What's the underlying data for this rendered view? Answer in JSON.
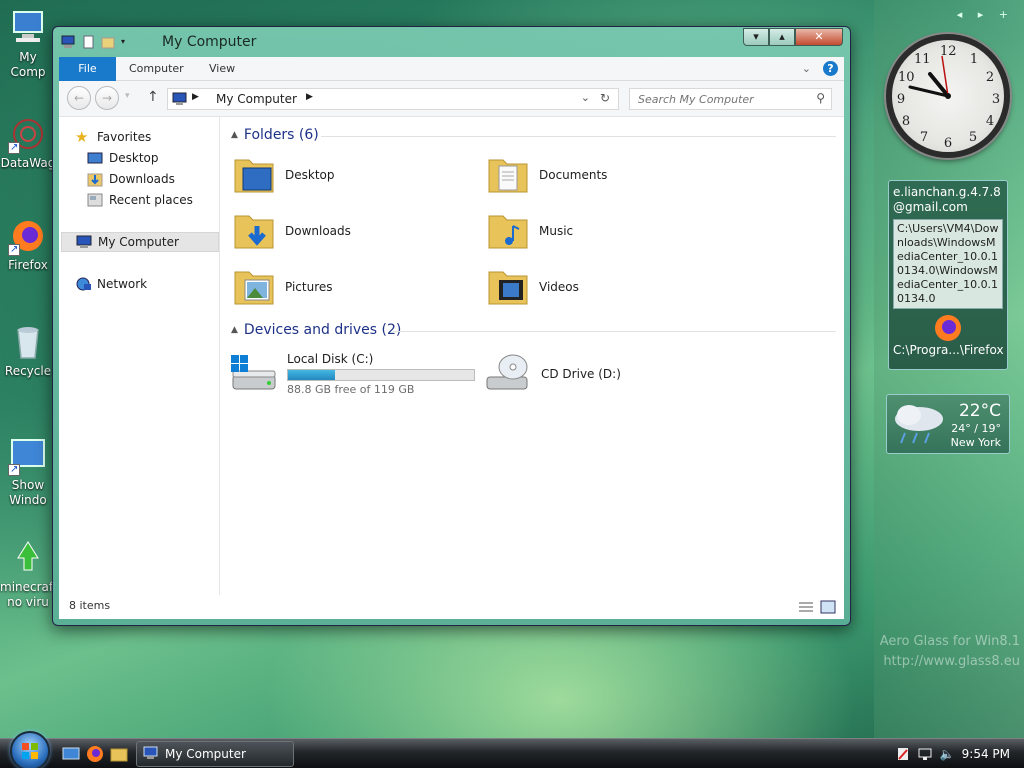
{
  "desktop": {
    "icons": [
      {
        "label": "My Comp",
        "icon": "computer-icon"
      },
      {
        "label": "DataWag",
        "icon": "datawag-icon"
      },
      {
        "label": "Firefox",
        "icon": "firefox-icon"
      },
      {
        "label": "Recycle",
        "icon": "recycle-bin-icon"
      },
      {
        "label": "Show Windo",
        "icon": "show-desktop-icon"
      },
      {
        "label": "minecraft no viru",
        "icon": "minecraft-icon"
      }
    ],
    "watermark_line1": "Aero Glass for Win8.1",
    "watermark_line2": "http://www.glass8.eu"
  },
  "sidebar": {
    "controls": "◂ ▸ +",
    "clock_numbers": [
      "12",
      "1",
      "2",
      "3",
      "4",
      "5",
      "6",
      "7",
      "8",
      "9",
      "10",
      "11"
    ],
    "clock_time": "9:54",
    "gadget": {
      "email": "e.lianchan.g.4.7.8 @gmail.com",
      "path": "C:\\Users\\VM4\\Downloads\\WindowsMediaCenter_10.0.10134.0\\WindowsMediaCenter_10.0.10134.0",
      "shortcut_label": "C:\\Progra...\\Firefox"
    },
    "weather": {
      "temp": "22°C",
      "range": "24° / 19°",
      "city": "New York"
    }
  },
  "window": {
    "title": "My Computer",
    "ribbon": {
      "tabs": [
        "File",
        "Computer",
        "View"
      ]
    },
    "address": {
      "crumb": "My Computer"
    },
    "search": {
      "placeholder": "Search My Computer"
    },
    "nav": {
      "favorites": "Favorites",
      "desktop": "Desktop",
      "downloads": "Downloads",
      "recent": "Recent places",
      "my_computer": "My Computer",
      "network": "Network"
    },
    "folders_heading": "Folders (6)",
    "folders": [
      {
        "label": "Desktop",
        "icon": "desktop-folder-icon"
      },
      {
        "label": "Documents",
        "icon": "documents-folder-icon"
      },
      {
        "label": "Downloads",
        "icon": "downloads-folder-icon"
      },
      {
        "label": "Music",
        "icon": "music-folder-icon"
      },
      {
        "label": "Pictures",
        "icon": "pictures-folder-icon"
      },
      {
        "label": "Videos",
        "icon": "videos-folder-icon"
      }
    ],
    "drives_heading": "Devices and drives (2)",
    "drives": {
      "local": {
        "label": "Local Disk (C:)",
        "free": "88.8 GB free of 119 GB",
        "used_fraction": 0.254
      },
      "cd": {
        "label": "CD Drive (D:)"
      }
    },
    "status": "8 items"
  },
  "taskbar": {
    "task_label": "My Computer",
    "time": "9:54 PM"
  },
  "colors": {
    "accent": "#1979ca",
    "group_heading": "#1e3287",
    "drive_fill": "#2488c0"
  }
}
